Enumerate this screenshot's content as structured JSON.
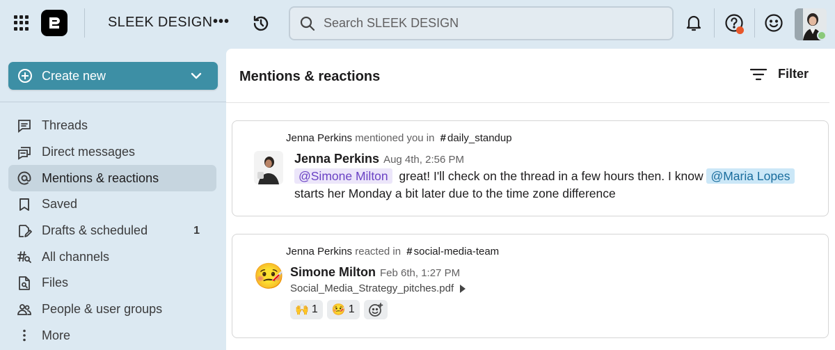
{
  "topbar": {
    "workspace_name": "SLEEK DESIGN",
    "more_label": "•••",
    "search_placeholder": "Search SLEEK DESIGN",
    "icons": [
      "apps-grid-icon",
      "workspace-logo-icon",
      "history-icon",
      "search-icon",
      "bell-icon",
      "help-icon",
      "emoji-icon"
    ],
    "status_color": "#8ac97a",
    "notification_color": "#e8572a"
  },
  "sidebar": {
    "create_label": "Create new",
    "accent": "#3d8fa5",
    "items": [
      {
        "label": "Threads",
        "icon": "threads-icon",
        "count": ""
      },
      {
        "label": "Direct messages",
        "icon": "direct-messages-icon",
        "count": ""
      },
      {
        "label": "Mentions & reactions",
        "icon": "at-sign-icon",
        "count": "",
        "active": true
      },
      {
        "label": "Saved",
        "icon": "bookmark-icon",
        "count": ""
      },
      {
        "label": "Drafts & scheduled",
        "icon": "drafts-icon",
        "count": "1"
      },
      {
        "label": "All channels",
        "icon": "channel-search-icon",
        "count": ""
      },
      {
        "label": "Files",
        "icon": "files-icon",
        "count": ""
      },
      {
        "label": "People & user groups",
        "icon": "people-icon",
        "count": ""
      },
      {
        "label": "More",
        "icon": "more-vertical-icon",
        "count": ""
      }
    ]
  },
  "main": {
    "title": "Mentions & reactions",
    "filter_label": "Filter",
    "cards": [
      {
        "actor": "Jenna Perkins",
        "action": "mentioned you in",
        "channel": "daily_standup",
        "author": "Jenna Perkins",
        "time": "Aug 4th, 2:56 PM",
        "mention_1": "@Simone Milton",
        "text_1": "great! I'll check on the thread in a few hours then. I know",
        "mention_2": "@Maria Lopes",
        "text_2": "starts her Monday a bit later due to the time zone difference"
      },
      {
        "actor": "Jenna Perkins",
        "action": "reacted in",
        "channel": "social-media-team",
        "author": "Simone Milton",
        "time": "Feb 6th, 1:27 PM",
        "file": "Social_Media_Strategy_pitches.pdf",
        "reaction_emoji": "🤒",
        "reactions": [
          {
            "emoji": "🙌",
            "count": "1"
          },
          {
            "emoji": "🤒",
            "count": "1"
          }
        ],
        "add_reaction_icon": "add-reaction-icon"
      }
    ]
  }
}
